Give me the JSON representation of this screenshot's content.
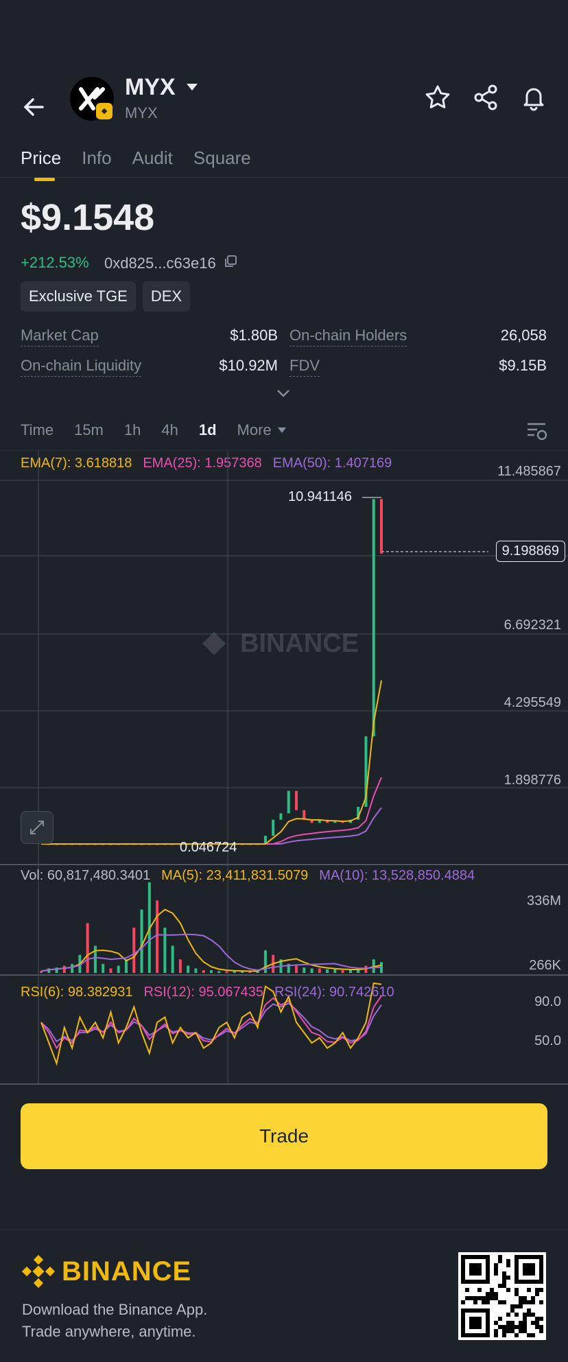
{
  "header": {
    "coin_name": "MYX",
    "coin_sub": "MYX",
    "icons": [
      "back-arrow-icon",
      "star-icon",
      "share-icon",
      "bell-icon",
      "caret-down-icon",
      "bnb-badge-icon"
    ]
  },
  "tabs": [
    {
      "label": "Price",
      "active": true
    },
    {
      "label": "Info",
      "active": false
    },
    {
      "label": "Audit",
      "active": false
    },
    {
      "label": "Square",
      "active": false
    }
  ],
  "price": {
    "value": "$9.1548",
    "change": "+212.53%",
    "address": "0xd825...c63e16"
  },
  "tags": [
    "Exclusive TGE",
    "DEX"
  ],
  "stats": {
    "market_cap_label": "Market Cap",
    "market_cap_value": "$1.80B",
    "holders_label": "On-chain Holders",
    "holders_value": "26,058",
    "liquidity_label": "On-chain Liquidity",
    "liquidity_value": "$10.92M",
    "fdv_label": "FDV",
    "fdv_value": "$9.15B"
  },
  "timeframes": {
    "time": "Time",
    "m15": "15m",
    "h1": "1h",
    "h4": "4h",
    "d1": "1d",
    "more": "More",
    "active": "1d"
  },
  "chart_data": {
    "type": "line",
    "legend_ema": {
      "ema7": "EMA(7): 3.618818",
      "ema25": "EMA(25): 1.957368",
      "ema50": "EMA(50): 1.407169"
    },
    "price_axis": [
      "11.485867",
      "6.692321",
      "4.295549",
      "1.898776"
    ],
    "current_price_tag": "9.198869",
    "high_label": "10.941146",
    "low_label": "0.046724",
    "watermark": "BINANCE",
    "price_series": [
      0.05,
      0.05,
      0.05,
      0.04,
      0.05,
      0.05,
      0.05,
      0.05,
      0.05,
      0.05,
      0.06,
      0.05,
      0.05,
      0.05,
      0.05,
      0.05,
      0.05,
      0.05,
      0.05,
      0.05,
      0.05,
      0.05,
      0.05,
      0.06,
      0.05,
      0.05,
      0.06,
      0.06,
      0.07,
      0.4,
      0.9,
      1.1,
      1.8,
      1.2,
      0.9,
      0.8,
      0.9,
      0.8,
      0.85,
      0.8,
      0.9,
      1.3,
      3.5,
      10.9,
      9.2
    ],
    "volume_legend": {
      "vol": "Vol: 60,817,480.3401",
      "ma5": "MA(5): 23,411,831.5079",
      "ma10": "MA(10): 13,528,850.4884"
    },
    "volume_axis": [
      "336M",
      "266K"
    ],
    "rsi_legend": {
      "rsi6": "RSI(6): 98.382931",
      "rsi12": "RSI(12): 95.067435",
      "rsi24": "RSI(24): 90.742610"
    },
    "rsi_axis": [
      "90.0",
      "50.0"
    ]
  },
  "trade_label": "Trade",
  "footer": {
    "brand": "BINANCE",
    "line1": "Download the Binance App.",
    "line2": "Trade anywhere, anytime."
  },
  "colors": {
    "accent": "#fcd535",
    "up": "#2ebd85",
    "ema7": "#f0b90b",
    "ema25": "#e84fb0",
    "ema50": "#9c6ad9"
  }
}
